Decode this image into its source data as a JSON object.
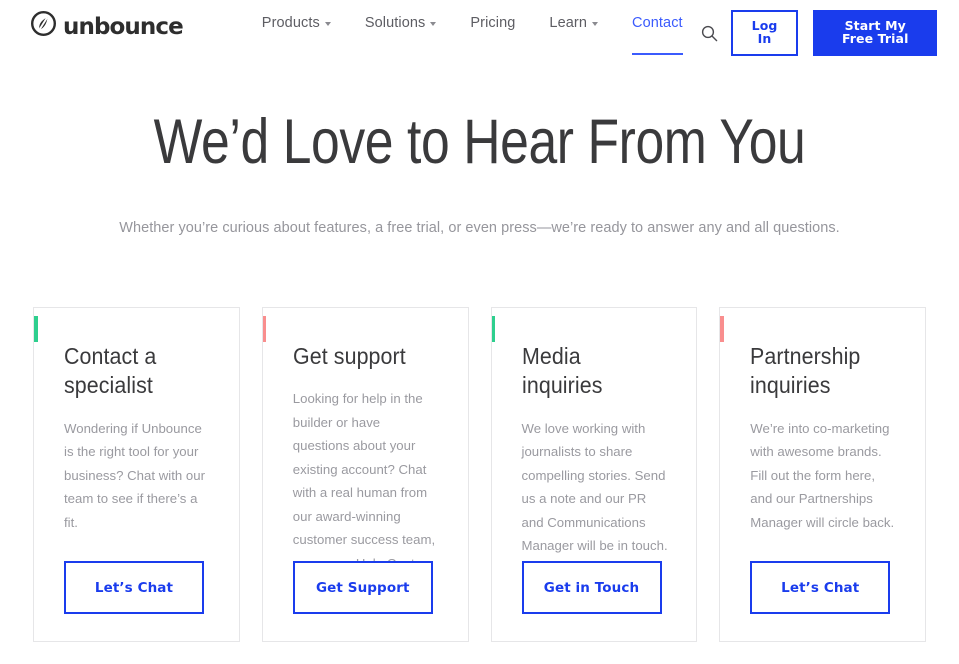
{
  "brand": {
    "name": "unbounce",
    "logo_icon": "unbounce-circle-leaf-icon"
  },
  "nav": {
    "items": [
      {
        "label": "Products",
        "has_caret": true,
        "active": false
      },
      {
        "label": "Solutions",
        "has_caret": true,
        "active": false
      },
      {
        "label": "Pricing",
        "has_caret": false,
        "active": false
      },
      {
        "label": "Learn",
        "has_caret": true,
        "active": false
      },
      {
        "label": "Contact",
        "has_caret": false,
        "active": true
      }
    ],
    "search_icon": "search-icon",
    "login_label": "Log In",
    "trial_label": "Start My Free Trial"
  },
  "hero": {
    "title": "We’d Love to Hear From You",
    "subtitle": "Whether you’re curious about features, a free trial, or even press—we’re ready to answer any and all questions."
  },
  "cards": [
    {
      "title": "Contact a specialist",
      "body": "Wondering if Unbounce is the right tool for your business? Chat with our team to see if there’s a fit.",
      "button": "Let’s Chat",
      "accent": "#2ecf8e"
    },
    {
      "title": "Get support",
      "body": "Looking for help in the builder or have questions about your existing account? Chat with a real human from our award-winning customer success team, or see our Help Center.",
      "button": "Get Support",
      "accent": "#f98e8e"
    },
    {
      "title": "Media inquiries",
      "body": "We love working with journalists to share compelling stories. Send us a note and our PR and Communications Manager will be in touch.",
      "button": "Get in Touch",
      "accent": "#2ecf8e"
    },
    {
      "title": "Partnership inquiries",
      "body": "We’re into co-marketing with awesome brands. Fill out the form here, and our Partnerships Manager will circle back.",
      "button": "Let’s Chat",
      "accent": "#f98e8e"
    }
  ],
  "colors": {
    "brand_blue": "#1a3ced",
    "link_blue": "#3b5bfd",
    "accent_green": "#2ecf8e",
    "accent_pink": "#f98e8e"
  }
}
